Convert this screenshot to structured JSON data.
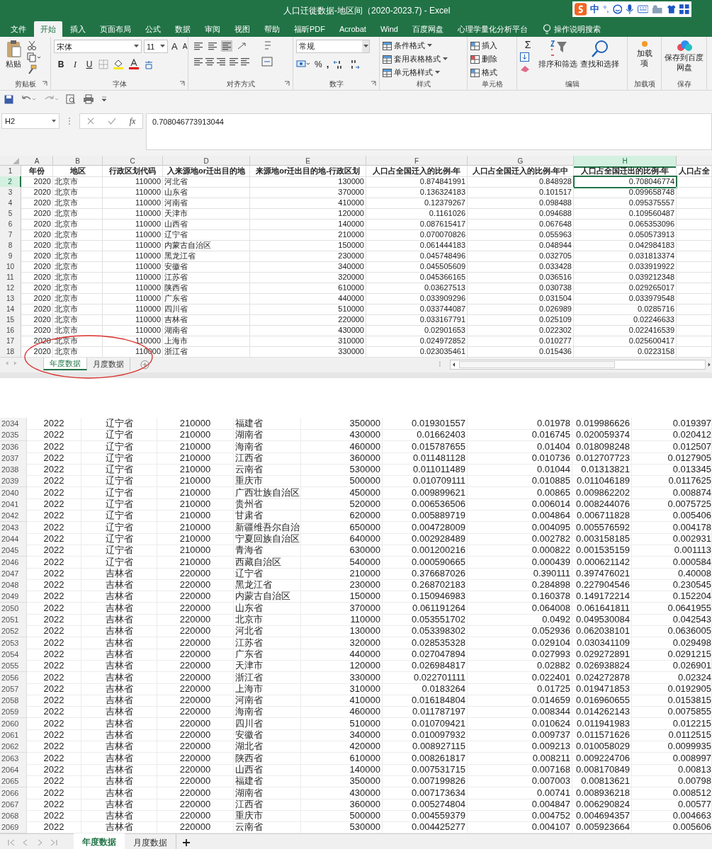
{
  "window": {
    "title": "人口迁徙数据-地区间（2020-2023.7)  -  Excel"
  },
  "ime_toolbar": {
    "labels": [
      "中",
      "°,"
    ]
  },
  "ribbon_tabs": [
    {
      "label": "文件",
      "selected": false
    },
    {
      "label": "开始",
      "selected": true
    },
    {
      "label": "插入",
      "selected": false
    },
    {
      "label": "页面布局",
      "selected": false
    },
    {
      "label": "公式",
      "selected": false
    },
    {
      "label": "数据",
      "selected": false
    },
    {
      "label": "审阅",
      "selected": false
    },
    {
      "label": "视图",
      "selected": false
    },
    {
      "label": "帮助",
      "selected": false
    },
    {
      "label": "福昕PDF",
      "selected": false
    },
    {
      "label": "Acrobat",
      "selected": false
    },
    {
      "label": "Wind",
      "selected": false
    },
    {
      "label": "百度网盘",
      "selected": false
    },
    {
      "label": "心理学量化分析平台",
      "selected": false
    }
  ],
  "search": {
    "placeholder": "操作说明搜索"
  },
  "ribbon": {
    "clipboard": {
      "paste": "粘贴",
      "label": "剪贴板"
    },
    "font": {
      "name": "宋体",
      "size": "11",
      "size_buttons": [
        "A",
        "A"
      ],
      "style_buttons": [
        "B",
        "I",
        "U"
      ],
      "label": "字体"
    },
    "alignment": {
      "label": "对齐方式"
    },
    "number": {
      "format": "常规",
      "symbols": [
        "%",
        ","
      ],
      "label": "数字"
    },
    "styles": {
      "items": [
        "条件格式",
        "套用表格格式",
        "单元格样式"
      ],
      "label": "样式"
    },
    "cells": {
      "items": [
        "插入",
        "删除",
        "格式"
      ],
      "label": "单元格"
    },
    "editing": {
      "sum": "Σ",
      "items": [
        "排序和筛选",
        "查找和选择"
      ],
      "label": "编辑"
    },
    "addins": {
      "button": "加载项",
      "label": "加载项"
    },
    "save": {
      "button": "保存到百度网盘",
      "label": "保存"
    }
  },
  "formula_bar": {
    "name_box": "H2",
    "fx": "fx",
    "value": "0.708046773913044"
  },
  "upper_sheet": {
    "columns": [
      {
        "label": "A",
        "selected": false
      },
      {
        "label": "B",
        "selected": false
      },
      {
        "label": "C",
        "selected": false
      },
      {
        "label": "D",
        "selected": false
      },
      {
        "label": "E",
        "selected": false
      },
      {
        "label": "F",
        "selected": false
      },
      {
        "label": "G",
        "selected": false
      },
      {
        "label": "H",
        "selected": true
      }
    ],
    "rows": [
      {
        "row_number": "1",
        "selected": false,
        "cells": [
          "年份",
          "地区",
          "行政区划代码",
          "入来源地or迁出目的地",
          "来源地or迁出目的地-行政区划",
          "人口占全国迁入的比例-年",
          "人口占全国迁入的比例-年中",
          "人口占全国迁出的比例-年",
          "人口占全"
        ]
      },
      {
        "row_number": "2",
        "selected": true,
        "cells": [
          "2020",
          "北京市",
          "110000",
          "河北省",
          "130000",
          "0.874841991",
          "0.848928",
          "0.708046774"
        ]
      },
      {
        "row_number": "3",
        "selected": false,
        "cells": [
          "2020",
          "北京市",
          "110000",
          "山东省",
          "370000",
          "0.136324183",
          "0.101517",
          "0.099658748"
        ]
      },
      {
        "row_number": "4",
        "selected": false,
        "cells": [
          "2020",
          "北京市",
          "110000",
          "河南省",
          "410000",
          "0.12379267",
          "0.098488",
          "0.095375557"
        ]
      },
      {
        "row_number": "5",
        "selected": false,
        "cells": [
          "2020",
          "北京市",
          "110000",
          "天津市",
          "120000",
          "0.1161026",
          "0.094688",
          "0.109560487"
        ]
      },
      {
        "row_number": "6",
        "selected": false,
        "cells": [
          "2020",
          "北京市",
          "110000",
          "山西省",
          "140000",
          "0.087615417",
          "0.067648",
          "0.065353096"
        ]
      },
      {
        "row_number": "7",
        "selected": false,
        "cells": [
          "2020",
          "北京市",
          "110000",
          "辽宁省",
          "210000",
          "0.070070826",
          "0.055963",
          "0.050573913"
        ]
      },
      {
        "row_number": "8",
        "selected": false,
        "cells": [
          "2020",
          "北京市",
          "110000",
          "内蒙古自治区",
          "150000",
          "0.061444183",
          "0.048944",
          "0.042984183"
        ]
      },
      {
        "row_number": "9",
        "selected": false,
        "cells": [
          "2020",
          "北京市",
          "110000",
          "黑龙江省",
          "230000",
          "0.045748496",
          "0.032705",
          "0.031813374"
        ]
      },
      {
        "row_number": "10",
        "selected": false,
        "cells": [
          "2020",
          "北京市",
          "110000",
          "安徽省",
          "340000",
          "0.045505609",
          "0.033428",
          "0.033919922"
        ]
      },
      {
        "row_number": "11",
        "selected": false,
        "cells": [
          "2020",
          "北京市",
          "110000",
          "江苏省",
          "320000",
          "0.045366165",
          "0.036516",
          "0.039212348"
        ]
      },
      {
        "row_number": "12",
        "selected": false,
        "cells": [
          "2020",
          "北京市",
          "110000",
          "陕西省",
          "610000",
          "0.03627513",
          "0.030738",
          "0.029265017"
        ]
      },
      {
        "row_number": "13",
        "selected": false,
        "cells": [
          "2020",
          "北京市",
          "110000",
          "广东省",
          "440000",
          "0.033909296",
          "0.031504",
          "0.033979548"
        ]
      },
      {
        "row_number": "14",
        "selected": false,
        "cells": [
          "2020",
          "北京市",
          "110000",
          "四川省",
          "510000",
          "0.033744087",
          "0.026989",
          "0.0285716"
        ]
      },
      {
        "row_number": "15",
        "selected": false,
        "cells": [
          "2020",
          "北京市",
          "110000",
          "吉林省",
          "220000",
          "0.033167791",
          "0.025109",
          "0.02246633"
        ]
      },
      {
        "row_number": "16",
        "selected": false,
        "cells": [
          "2020",
          "北京市",
          "110000",
          "湖南省",
          "430000",
          "0.02901653",
          "0.022302",
          "0.022416539"
        ]
      },
      {
        "row_number": "17",
        "selected": false,
        "cells": [
          "2020",
          "北京市",
          "110000",
          "上海市",
          "310000",
          "0.024972852",
          "0.010277",
          "0.025600417"
        ]
      },
      {
        "row_number": "18",
        "selected": false,
        "cells": [
          "2020",
          "北京市",
          "110000",
          "浙江省",
          "330000",
          "0.023035461",
          "0.015436",
          "0.0223158"
        ]
      }
    ],
    "sheet_tabs": [
      {
        "label": "年度数据",
        "selected": true
      },
      {
        "label": "月度数据",
        "selected": false
      }
    ]
  },
  "lower_sheet": {
    "rows": [
      {
        "row_number": "2034",
        "cells": [
          "2022",
          "辽宁省",
          "210000",
          "福建省",
          "350000",
          "0.019301557",
          "0.01978",
          "0.019986626",
          "0.019397"
        ]
      },
      {
        "row_number": "2035",
        "cells": [
          "2022",
          "辽宁省",
          "210000",
          "湖南省",
          "430000",
          "0.01662403",
          "0.016745",
          "0.020059374",
          "0.020412"
        ]
      },
      {
        "row_number": "2036",
        "cells": [
          "2022",
          "辽宁省",
          "210000",
          "海南省",
          "460000",
          "0.015787655",
          "0.01404",
          "0.018098248",
          "0.012507"
        ]
      },
      {
        "row_number": "2037",
        "cells": [
          "2022",
          "辽宁省",
          "210000",
          "江西省",
          "360000",
          "0.011481128",
          "0.010736",
          "0.012707723",
          "0.0127905"
        ]
      },
      {
        "row_number": "2038",
        "cells": [
          "2022",
          "辽宁省",
          "210000",
          "云南省",
          "530000",
          "0.011011489",
          "0.01044",
          "0.01313821",
          "0.013345"
        ]
      },
      {
        "row_number": "2039",
        "cells": [
          "2022",
          "辽宁省",
          "210000",
          "重庆市",
          "500000",
          "0.010709111",
          "0.010885",
          "0.011046189",
          "0.0117625"
        ]
      },
      {
        "row_number": "2040",
        "cells": [
          "2022",
          "辽宁省",
          "210000",
          "广西壮族自治区",
          "450000",
          "0.009899621",
          "0.00865",
          "0.009862202",
          "0.008874"
        ]
      },
      {
        "row_number": "2041",
        "cells": [
          "2022",
          "辽宁省",
          "210000",
          "贵州省",
          "520000",
          "0.006536506",
          "0.006014",
          "0.008244076",
          "0.0075725"
        ]
      },
      {
        "row_number": "2042",
        "cells": [
          "2022",
          "辽宁省",
          "210000",
          "甘肃省",
          "620000",
          "0.005889719",
          "0.004864",
          "0.006711828",
          "0.005406"
        ]
      },
      {
        "row_number": "2043",
        "cells": [
          "2022",
          "辽宁省",
          "210000",
          "新疆维吾尔自治",
          "650000",
          "0.004728009",
          "0.004095",
          "0.005576592",
          "0.004178"
        ]
      },
      {
        "row_number": "2044",
        "cells": [
          "2022",
          "辽宁省",
          "210000",
          "宁夏回族自治区",
          "640000",
          "0.002928489",
          "0.002782",
          "0.003158185",
          "0.002931"
        ]
      },
      {
        "row_number": "2045",
        "cells": [
          "2022",
          "辽宁省",
          "210000",
          "青海省",
          "630000",
          "0.001200216",
          "0.000822",
          "0.001535159",
          "0.001113"
        ]
      },
      {
        "row_number": "2046",
        "cells": [
          "2022",
          "辽宁省",
          "210000",
          "西藏自治区",
          "540000",
          "0.000590665",
          "0.000439",
          "0.000621142",
          "0.000584"
        ]
      },
      {
        "row_number": "2047",
        "cells": [
          "2022",
          "吉林省",
          "220000",
          "辽宁省",
          "210000",
          "0.376687026",
          "0.390111",
          "0.397476021",
          "0.40008"
        ]
      },
      {
        "row_number": "2048",
        "cells": [
          "2022",
          "吉林省",
          "220000",
          "黑龙江省",
          "230000",
          "0.268702183",
          "0.284898",
          "0.227904546",
          "0.230545"
        ]
      },
      {
        "row_number": "2049",
        "cells": [
          "2022",
          "吉林省",
          "220000",
          "内蒙古自治区",
          "150000",
          "0.150946983",
          "0.160378",
          "0.149172214",
          "0.152204"
        ]
      },
      {
        "row_number": "2050",
        "cells": [
          "2022",
          "吉林省",
          "220000",
          "山东省",
          "370000",
          "0.061191264",
          "0.064008",
          "0.061641811",
          "0.0641955"
        ]
      },
      {
        "row_number": "2051",
        "cells": [
          "2022",
          "吉林省",
          "220000",
          "北京市",
          "110000",
          "0.053551702",
          "0.0492",
          "0.049530084",
          "0.042543"
        ]
      },
      {
        "row_number": "2052",
        "cells": [
          "2022",
          "吉林省",
          "220000",
          "河北省",
          "130000",
          "0.053398302",
          "0.052936",
          "0.062038101",
          "0.0636005"
        ]
      },
      {
        "row_number": "2053",
        "cells": [
          "2022",
          "吉林省",
          "220000",
          "江苏省",
          "320000",
          "0.028535328",
          "0.029104",
          "0.030341109",
          "0.029498"
        ]
      },
      {
        "row_number": "2054",
        "cells": [
          "2022",
          "吉林省",
          "220000",
          "广东省",
          "440000",
          "0.027047894",
          "0.027993",
          "0.029272891",
          "0.0291215"
        ]
      },
      {
        "row_number": "2055",
        "cells": [
          "2022",
          "吉林省",
          "220000",
          "天津市",
          "120000",
          "0.026984817",
          "0.02882",
          "0.026938824",
          "0.026901"
        ]
      },
      {
        "row_number": "2056",
        "cells": [
          "2022",
          "吉林省",
          "220000",
          "浙江省",
          "330000",
          "0.022701111",
          "0.022401",
          "0.024272878",
          "0.02324"
        ]
      },
      {
        "row_number": "2057",
        "cells": [
          "2022",
          "吉林省",
          "220000",
          "上海市",
          "310000",
          "0.0183264",
          "0.01725",
          "0.019471853",
          "0.0192905"
        ]
      },
      {
        "row_number": "2058",
        "cells": [
          "2022",
          "吉林省",
          "220000",
          "河南省",
          "410000",
          "0.016184804",
          "0.014659",
          "0.016960655",
          "0.0153815"
        ]
      },
      {
        "row_number": "2059",
        "cells": [
          "2022",
          "吉林省",
          "220000",
          "海南省",
          "460000",
          "0.011787197",
          "0.008344",
          "0.014262143",
          "0.0075855"
        ]
      },
      {
        "row_number": "2060",
        "cells": [
          "2022",
          "吉林省",
          "220000",
          "四川省",
          "510000",
          "0.010709421",
          "0.010624",
          "0.011941983",
          "0.012215"
        ]
      },
      {
        "row_number": "2061",
        "cells": [
          "2022",
          "吉林省",
          "220000",
          "安徽省",
          "340000",
          "0.010097932",
          "0.009737",
          "0.011571626",
          "0.0112515"
        ]
      },
      {
        "row_number": "2062",
        "cells": [
          "2022",
          "吉林省",
          "220000",
          "湖北省",
          "420000",
          "0.008927115",
          "0.009213",
          "0.010058029",
          "0.0099935"
        ]
      },
      {
        "row_number": "2063",
        "cells": [
          "2022",
          "吉林省",
          "220000",
          "陕西省",
          "610000",
          "0.008261817",
          "0.008211",
          "0.009224706",
          "0.008997"
        ]
      },
      {
        "row_number": "2064",
        "cells": [
          "2022",
          "吉林省",
          "220000",
          "山西省",
          "140000",
          "0.007531715",
          "0.007168",
          "0.008170849",
          "0.00813"
        ]
      },
      {
        "row_number": "2065",
        "cells": [
          "2022",
          "吉林省",
          "220000",
          "福建省",
          "350000",
          "0.007199826",
          "0.007003",
          "0.00813621",
          "0.00798"
        ]
      },
      {
        "row_number": "2066",
        "cells": [
          "2022",
          "吉林省",
          "220000",
          "湖南省",
          "430000",
          "0.007173634",
          "0.00741",
          "0.008936218",
          "0.008512"
        ]
      },
      {
        "row_number": "2067",
        "cells": [
          "2022",
          "吉林省",
          "220000",
          "江西省",
          "360000",
          "0.005274804",
          "0.004847",
          "0.006290824",
          "0.00577"
        ]
      },
      {
        "row_number": "2068",
        "cells": [
          "2022",
          "吉林省",
          "220000",
          "重庆市",
          "500000",
          "0.004559379",
          "0.004752",
          "0.004694357",
          "0.004663"
        ]
      },
      {
        "row_number": "2069",
        "cells": [
          "2022",
          "吉林省",
          "220000",
          "云南省",
          "530000",
          "0.004425277",
          "0.004107",
          "0.005923664",
          "0.005606"
        ]
      }
    ],
    "sheet_tabs": [
      {
        "label": "年度数据",
        "selected": true
      },
      {
        "label": "月度数据",
        "selected": false
      }
    ]
  }
}
